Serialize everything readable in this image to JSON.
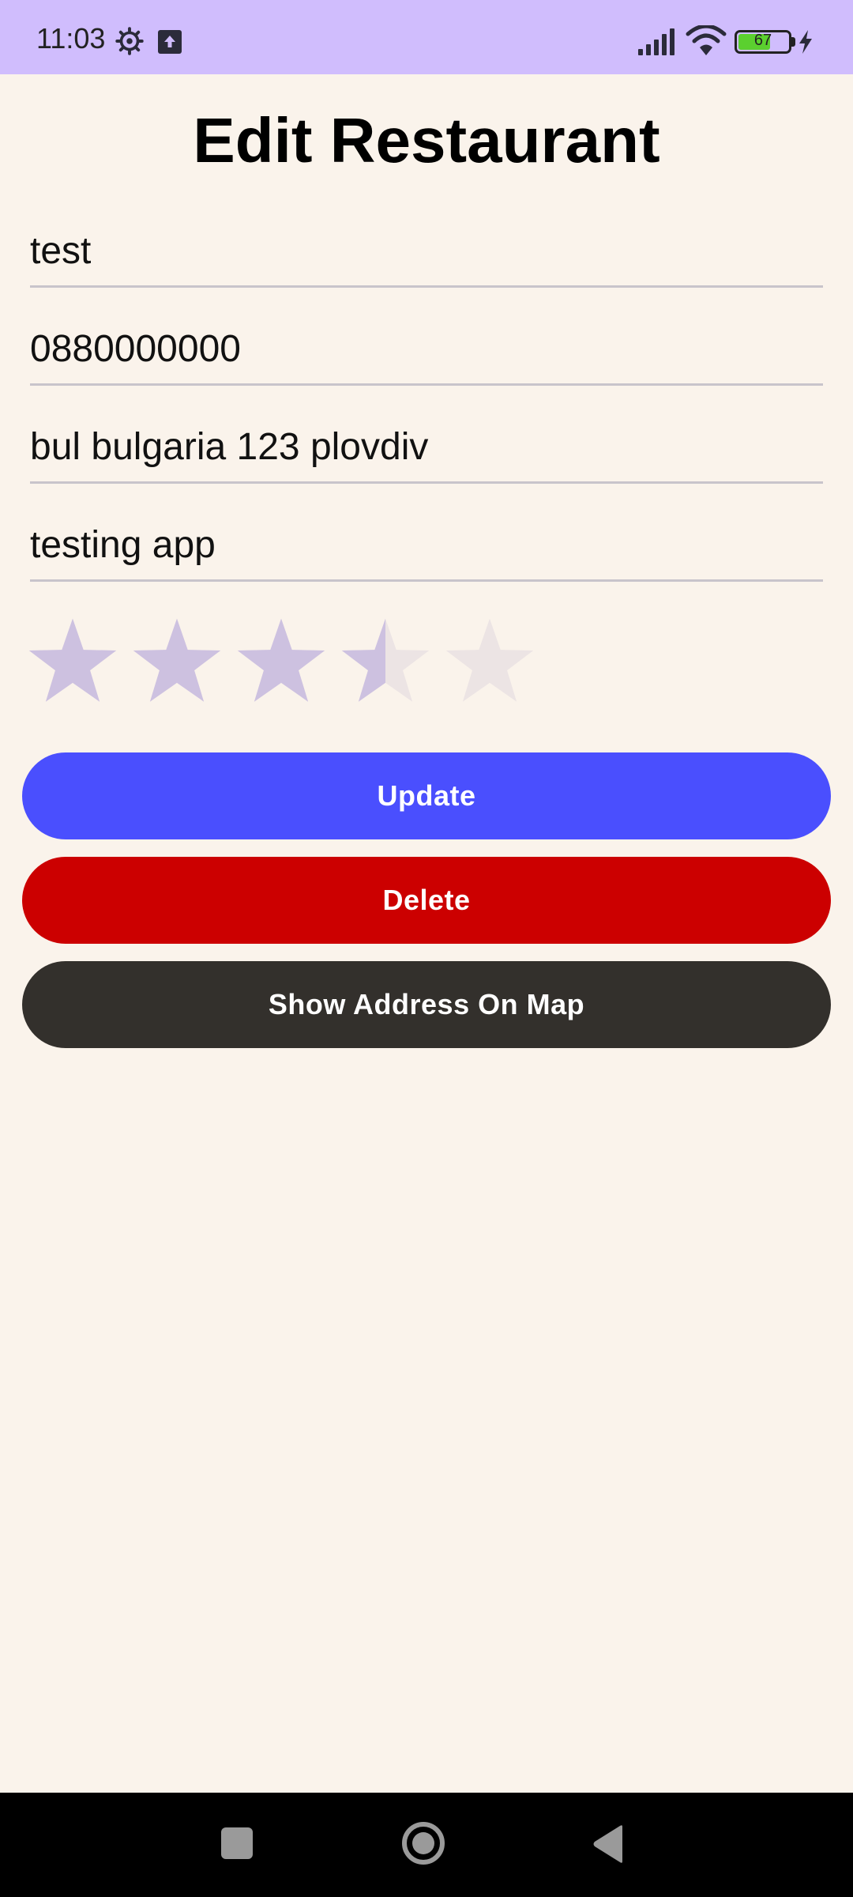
{
  "status_bar": {
    "time": "11:03",
    "battery_level": "67",
    "icons": [
      "gear-icon",
      "upload-icon",
      "signal-icon",
      "wifi-icon",
      "battery-icon",
      "charging-bolt-icon"
    ]
  },
  "header": {
    "title": "Edit Restaurant"
  },
  "form": {
    "name": "test",
    "phone": "0880000000",
    "address": "bul bulgaria 123 plovdiv",
    "description": "testing app"
  },
  "rating": {
    "value": 3.5,
    "max": 5,
    "filled_color": "#cdc1e0",
    "empty_color": "#ece4e4"
  },
  "buttons": {
    "update": "Update",
    "delete": "Delete",
    "show_map": "Show Address On Map"
  },
  "colors": {
    "status_bar": "#d0bdfd",
    "background": "#faf3eb",
    "update": "#4a4ffe",
    "delete": "#cc0000",
    "map": "#33302c"
  },
  "nav_bar": {
    "icons": [
      "recents-icon",
      "home-icon",
      "back-icon"
    ]
  }
}
